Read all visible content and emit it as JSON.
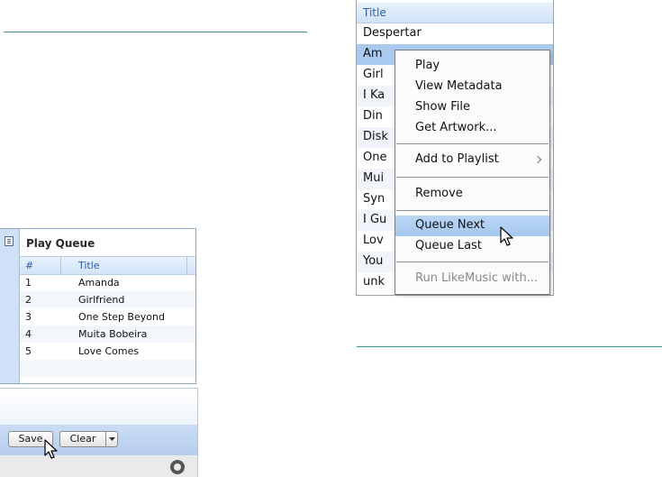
{
  "play_queue": {
    "title": "Play Queue",
    "columns": {
      "number": "#",
      "title": "Title"
    },
    "rows": [
      {
        "num": "1",
        "title": "Amanda"
      },
      {
        "num": "2",
        "title": "Girlfriend"
      },
      {
        "num": "3",
        "title": "One Step Beyond"
      },
      {
        "num": "4",
        "title": "Muita Bobeira"
      },
      {
        "num": "5",
        "title": "Love Comes"
      }
    ]
  },
  "toolbar": {
    "save_label": "Save",
    "clear_label": "Clear"
  },
  "track_list": {
    "header": "Title",
    "rows": [
      "Despertar",
      "Am",
      "Girl",
      "I Ka",
      "Din",
      "Disk",
      "One",
      "Mui",
      "Syn",
      "I Gu",
      "Lov",
      "You",
      "unk"
    ]
  },
  "context_menu": {
    "items": {
      "play": "Play",
      "view_metadata": "View Metadata",
      "show_file": "Show File",
      "get_artwork": "Get Artwork...",
      "add_to_playlist": "Add to Playlist",
      "remove": "Remove",
      "queue_next": "Queue Next",
      "queue_last": "Queue Last",
      "run_likemusic": "Run LikeMusic with..."
    }
  },
  "colors": {
    "accent_rule": "#3f8f8a",
    "selection": "#a9c9ef",
    "header_text": "#2a5fa8"
  },
  "icons": [
    "document-icon",
    "dropdown-arrow-icon",
    "logo-icon",
    "submenu-arrow-icon",
    "mouse-cursor-icon"
  ]
}
